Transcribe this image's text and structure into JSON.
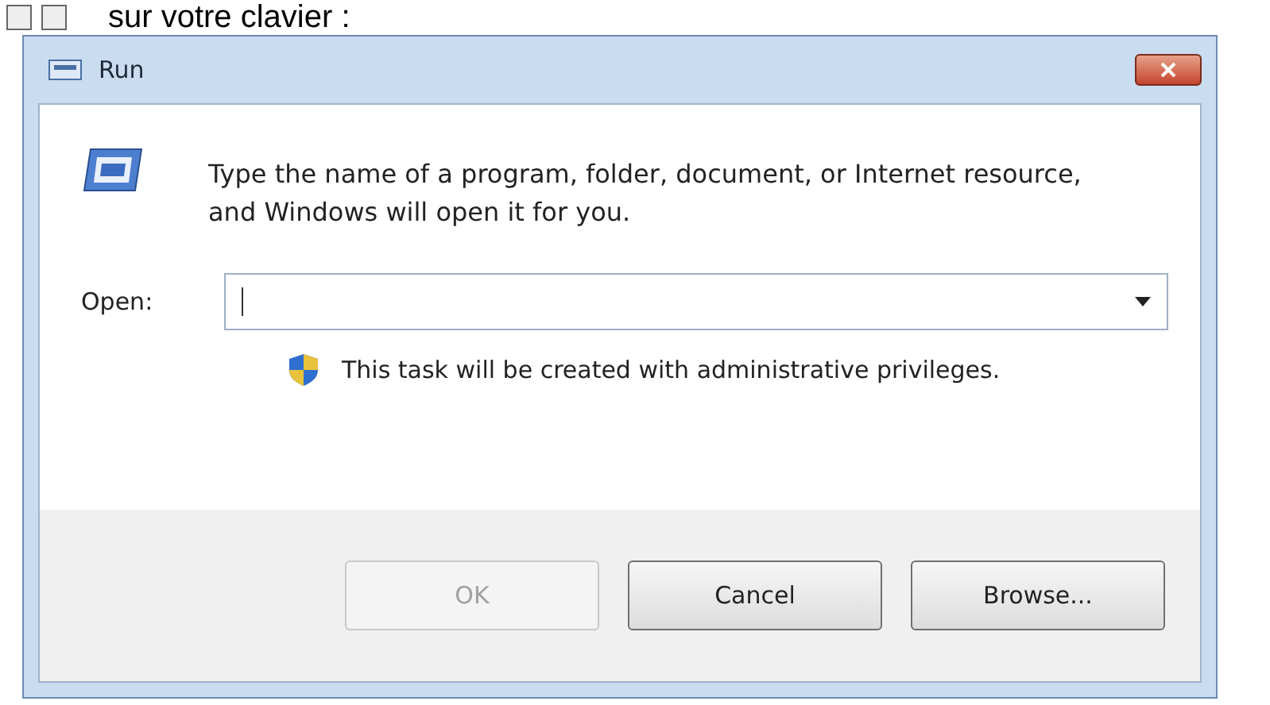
{
  "page_text": "sur votre clavier :",
  "window": {
    "title": "Run"
  },
  "description": "Type the name of a program, folder, document, or Internet resource, and Windows will open it for you.",
  "open_field": {
    "label": "Open:"
  },
  "admin_note": "This task will be created with administrative privileges.",
  "buttons": [
    {
      "label": "OK",
      "disabled": true
    },
    {
      "label": "Cancel",
      "disabled": false
    },
    {
      "label": "Browse...",
      "disabled": false
    }
  ]
}
